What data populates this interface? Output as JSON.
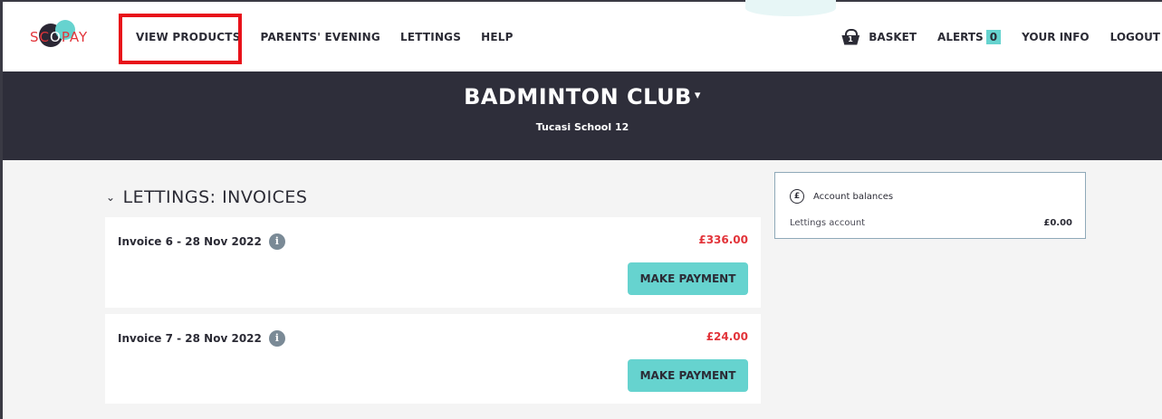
{
  "logo": {
    "text_red": "SC",
    "text_light": "O",
    "text_rest": "PAY"
  },
  "nav": {
    "items": [
      "VIEW PRODUCTS",
      "PARENTS' EVENING",
      "LETTINGS",
      "HELP"
    ]
  },
  "right_nav": {
    "basket_label": "BASKET",
    "basket_count": "1",
    "alerts_label": "ALERTS",
    "alerts_count": "0",
    "your_info": "YOUR INFO",
    "logout": "LOGOUT"
  },
  "hero": {
    "title": "BADMINTON CLUB",
    "caret": "▾",
    "subtitle": "Tucasi School 12"
  },
  "section": {
    "chevron": "⌄",
    "title": "LETTINGS: INVOICES"
  },
  "invoices": [
    {
      "label": "Invoice 6 - 28 Nov 2022",
      "amount": "£336.00",
      "button": "MAKE PAYMENT"
    },
    {
      "label": "Invoice 7 - 28 Nov 2022",
      "amount": "£24.00",
      "button": "MAKE PAYMENT"
    }
  ],
  "balances": {
    "title": "Account balances",
    "rows": [
      {
        "label": "Lettings account",
        "value": "£0.00"
      }
    ]
  },
  "colors": {
    "accent": "#66d3cf",
    "dark": "#2e2e3a",
    "amount_red": "#e2343a",
    "highlight_red": "#e8121a"
  }
}
